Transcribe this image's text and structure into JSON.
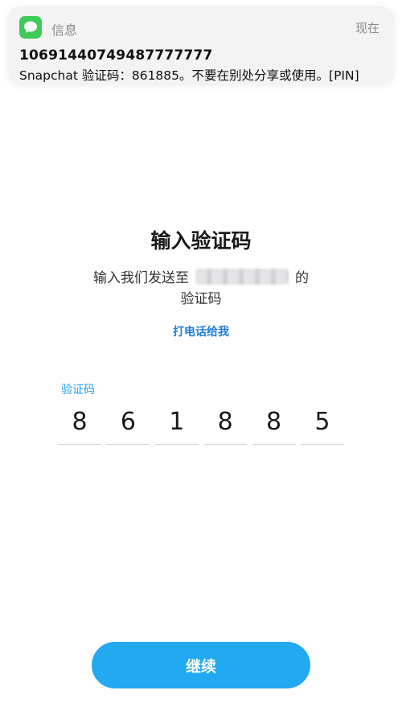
{
  "notification": {
    "app_icon": "messages-icon",
    "app_name": "信息",
    "time": "现在",
    "sender": "10691440749487777777",
    "body": "Snapchat 验证码：861885。不要在别处分享或使用。[PIN]"
  },
  "verify": {
    "title": "输入验证码",
    "desc_prefix": "输入我们发送至",
    "desc_suffix": "的",
    "desc_line2": "验证码",
    "call_link": "打电话给我",
    "code_label": "验证码",
    "digits": [
      "8",
      "6",
      "1",
      "8",
      "8",
      "5"
    ]
  },
  "continue_label": "继续",
  "colors": {
    "accent": "#22a9f2",
    "link": "#1d7fd6",
    "messages_green": "#3ecb57"
  }
}
